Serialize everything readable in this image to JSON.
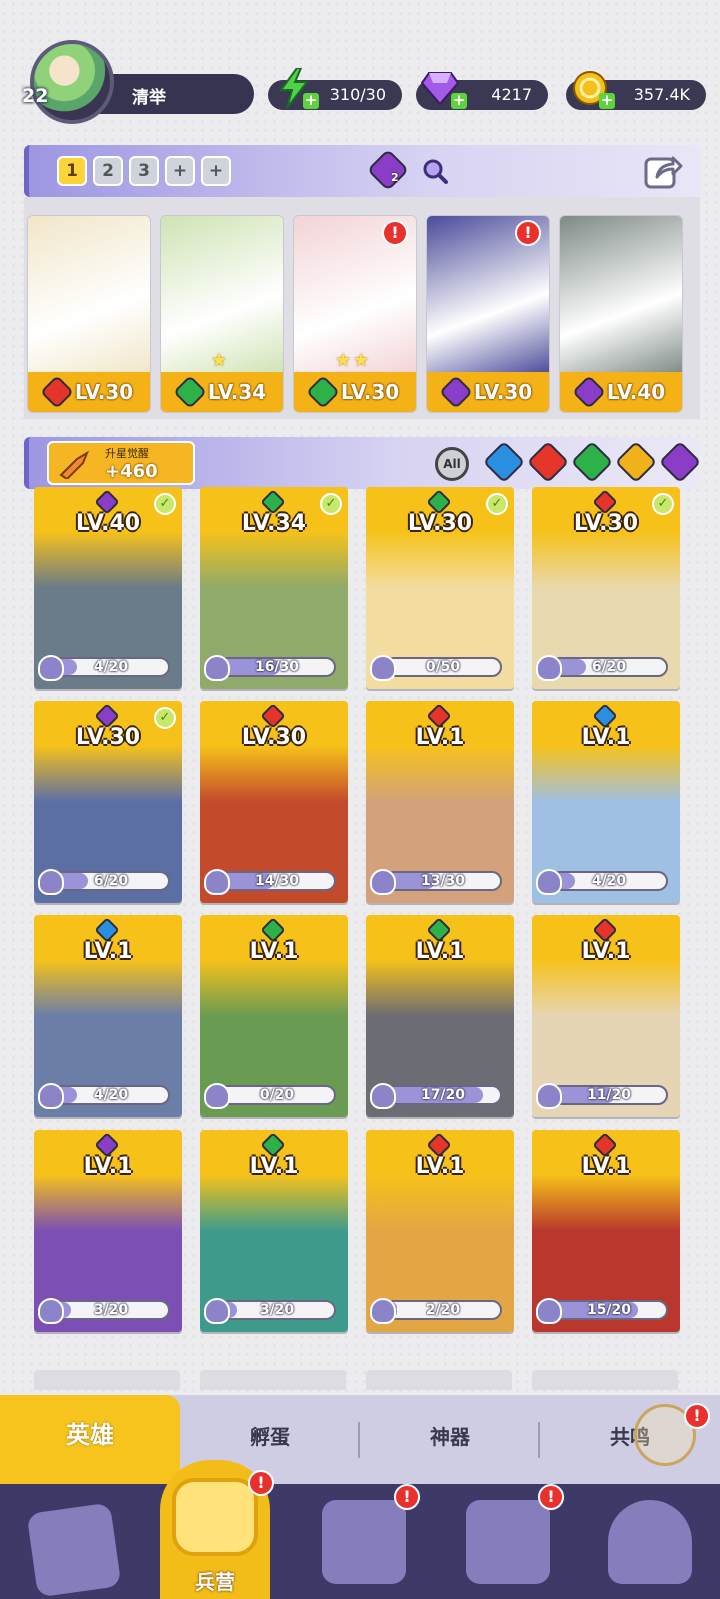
{
  "player": {
    "level": "22",
    "name": "清举"
  },
  "resources": {
    "energy": {
      "icon": "lightning-icon",
      "value": "310/30"
    },
    "gems": {
      "icon": "diamond-icon",
      "value": "4217"
    },
    "coins": {
      "icon": "coin-icon",
      "value": "357.4K"
    }
  },
  "team_tabs": [
    "1",
    "2",
    "3",
    "+",
    "+"
  ],
  "team_badge": "2",
  "team": [
    {
      "element": "fire",
      "level": "LV.30",
      "stars": 0,
      "alert": false,
      "art": "#f0e6c8"
    },
    {
      "element": "wind",
      "level": "LV.34",
      "stars": 1,
      "alert": false,
      "art": "#cfe3b4"
    },
    {
      "element": "wind",
      "level": "LV.30",
      "stars": 2,
      "alert": true,
      "art": "#f3d3d6"
    },
    {
      "element": "dark",
      "level": "LV.30",
      "stars": 0,
      "alert": true,
      "art": "#4a4a9a"
    },
    {
      "element": "dark",
      "level": "LV.40",
      "stars": 0,
      "alert": false,
      "art": "#7e8a86"
    }
  ],
  "star_up": {
    "label": "升星觉醒",
    "value": "+460"
  },
  "filters": {
    "all_label": "All",
    "elements": [
      "water",
      "fire",
      "wind",
      "light",
      "dark"
    ]
  },
  "heroes": [
    {
      "element": "dark",
      "level": "LV.40",
      "shards": "4/20",
      "progress": 0.2,
      "checked": true,
      "art": "#6a7b89"
    },
    {
      "element": "wind",
      "level": "LV.34",
      "shards": "16/30",
      "progress": 0.53,
      "checked": true,
      "art": "#8faa6a"
    },
    {
      "element": "wind",
      "level": "LV.30",
      "shards": "0/50",
      "progress": 0.0,
      "checked": true,
      "art": "#f2dca0"
    },
    {
      "element": "fire",
      "level": "LV.30",
      "shards": "6/20",
      "progress": 0.3,
      "checked": true,
      "art": "#e9d9ae"
    },
    {
      "element": "dark",
      "level": "LV.30",
      "shards": "6/20",
      "progress": 0.3,
      "checked": true,
      "art": "#5b6fa5"
    },
    {
      "element": "fire",
      "level": "LV.30",
      "shards": "14/30",
      "progress": 0.47,
      "checked": false,
      "art": "#c44a2c"
    },
    {
      "element": "fire",
      "level": "LV.1",
      "shards": "13/30",
      "progress": 0.43,
      "checked": false,
      "art": "#d3a27a"
    },
    {
      "element": "water",
      "level": "LV.1",
      "shards": "4/20",
      "progress": 0.2,
      "checked": false,
      "art": "#9fc0e3"
    },
    {
      "element": "water",
      "level": "LV.1",
      "shards": "4/20",
      "progress": 0.2,
      "checked": false,
      "art": "#6b7ea8"
    },
    {
      "element": "wind",
      "level": "LV.1",
      "shards": "0/20",
      "progress": 0.0,
      "checked": false,
      "art": "#6a9b52"
    },
    {
      "element": "wind",
      "level": "LV.1",
      "shards": "17/20",
      "progress": 0.85,
      "checked": false,
      "art": "#6c6c74"
    },
    {
      "element": "fire",
      "level": "LV.1",
      "shards": "11/20",
      "progress": 0.55,
      "checked": false,
      "art": "#e6d5b5"
    },
    {
      "element": "dark",
      "level": "LV.1",
      "shards": "3/20",
      "progress": 0.15,
      "checked": false,
      "art": "#7b4fb3"
    },
    {
      "element": "wind",
      "level": "LV.1",
      "shards": "3/20",
      "progress": 0.15,
      "checked": false,
      "art": "#3e9b8c"
    },
    {
      "element": "fire",
      "level": "LV.1",
      "shards": "2/20",
      "progress": 0.1,
      "checked": false,
      "art": "#e2a644"
    },
    {
      "element": "fire",
      "level": "LV.1",
      "shards": "15/20",
      "progress": 0.75,
      "checked": false,
      "art": "#b9372c"
    }
  ],
  "tabs": {
    "active": "英雄",
    "items": [
      "孵蛋",
      "神器",
      "共鸣"
    ]
  },
  "nav": {
    "active_label": "兵营",
    "items": [
      "cards-icon",
      "barracks-icon",
      "map-icon",
      "temple-icon",
      "mushroom-icon"
    ]
  },
  "colors": {
    "fire": "#e5342a",
    "water": "#2a8fe0",
    "wind": "#2db24a",
    "light": "#f0b21a",
    "dark": "#8a3ec8",
    "accent": "#f6c41c"
  }
}
